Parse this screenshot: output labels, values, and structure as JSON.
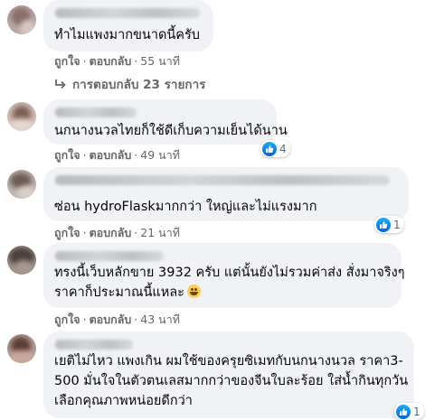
{
  "actions": {
    "like": "ถูกใจ",
    "reply": "ตอบกลับ",
    "dot": "·"
  },
  "replies_link": "การตอบกลับ 23 รายการ",
  "comments": [
    {
      "text_lines": [
        "ทำไมแพงมากขนาดนี้ครับ"
      ],
      "time": "55 นาที",
      "reactions": null
    },
    {
      "text_lines": [
        "นกนางนวลไทยก็ใช้ดีเก็บความเย็นได้นาน"
      ],
      "time": "49 นาที",
      "reactions": "4"
    },
    {
      "text_lines": [
        "ซ่อน hydroFlaskมากกว่า ใหญ่และไม่แรงมาก"
      ],
      "time": "21 นาที",
      "reactions": "1"
    },
    {
      "text_lines": [
        "ทรงนี้เว็บหลักขาย 3932 ครับ แต่นั้นยังไม่รวมค่าส่ง สั่งมาจริงๆ",
        "ราคาก็ประมาณนี้แหละ"
      ],
      "time": "43 นาที",
      "reactions": null
    },
    {
      "text_lines": [
        "เยติไม่ไหว แพงเกิน ผมใช้ของครุยซิเมทกับนกนางนวล ราคา3-",
        "500 มั่นใจในตัวตนเลสมากกว่าของจีนใบละร้อย ใส่น้ำกินทุกวัน",
        "เลือกคุณภาพหน่อยดีกว่า"
      ],
      "time": "",
      "reactions": "1"
    }
  ],
  "colors": {
    "bubble": "#f0f2f5",
    "meta": "#65676b",
    "like_blue": "#1877f2"
  }
}
